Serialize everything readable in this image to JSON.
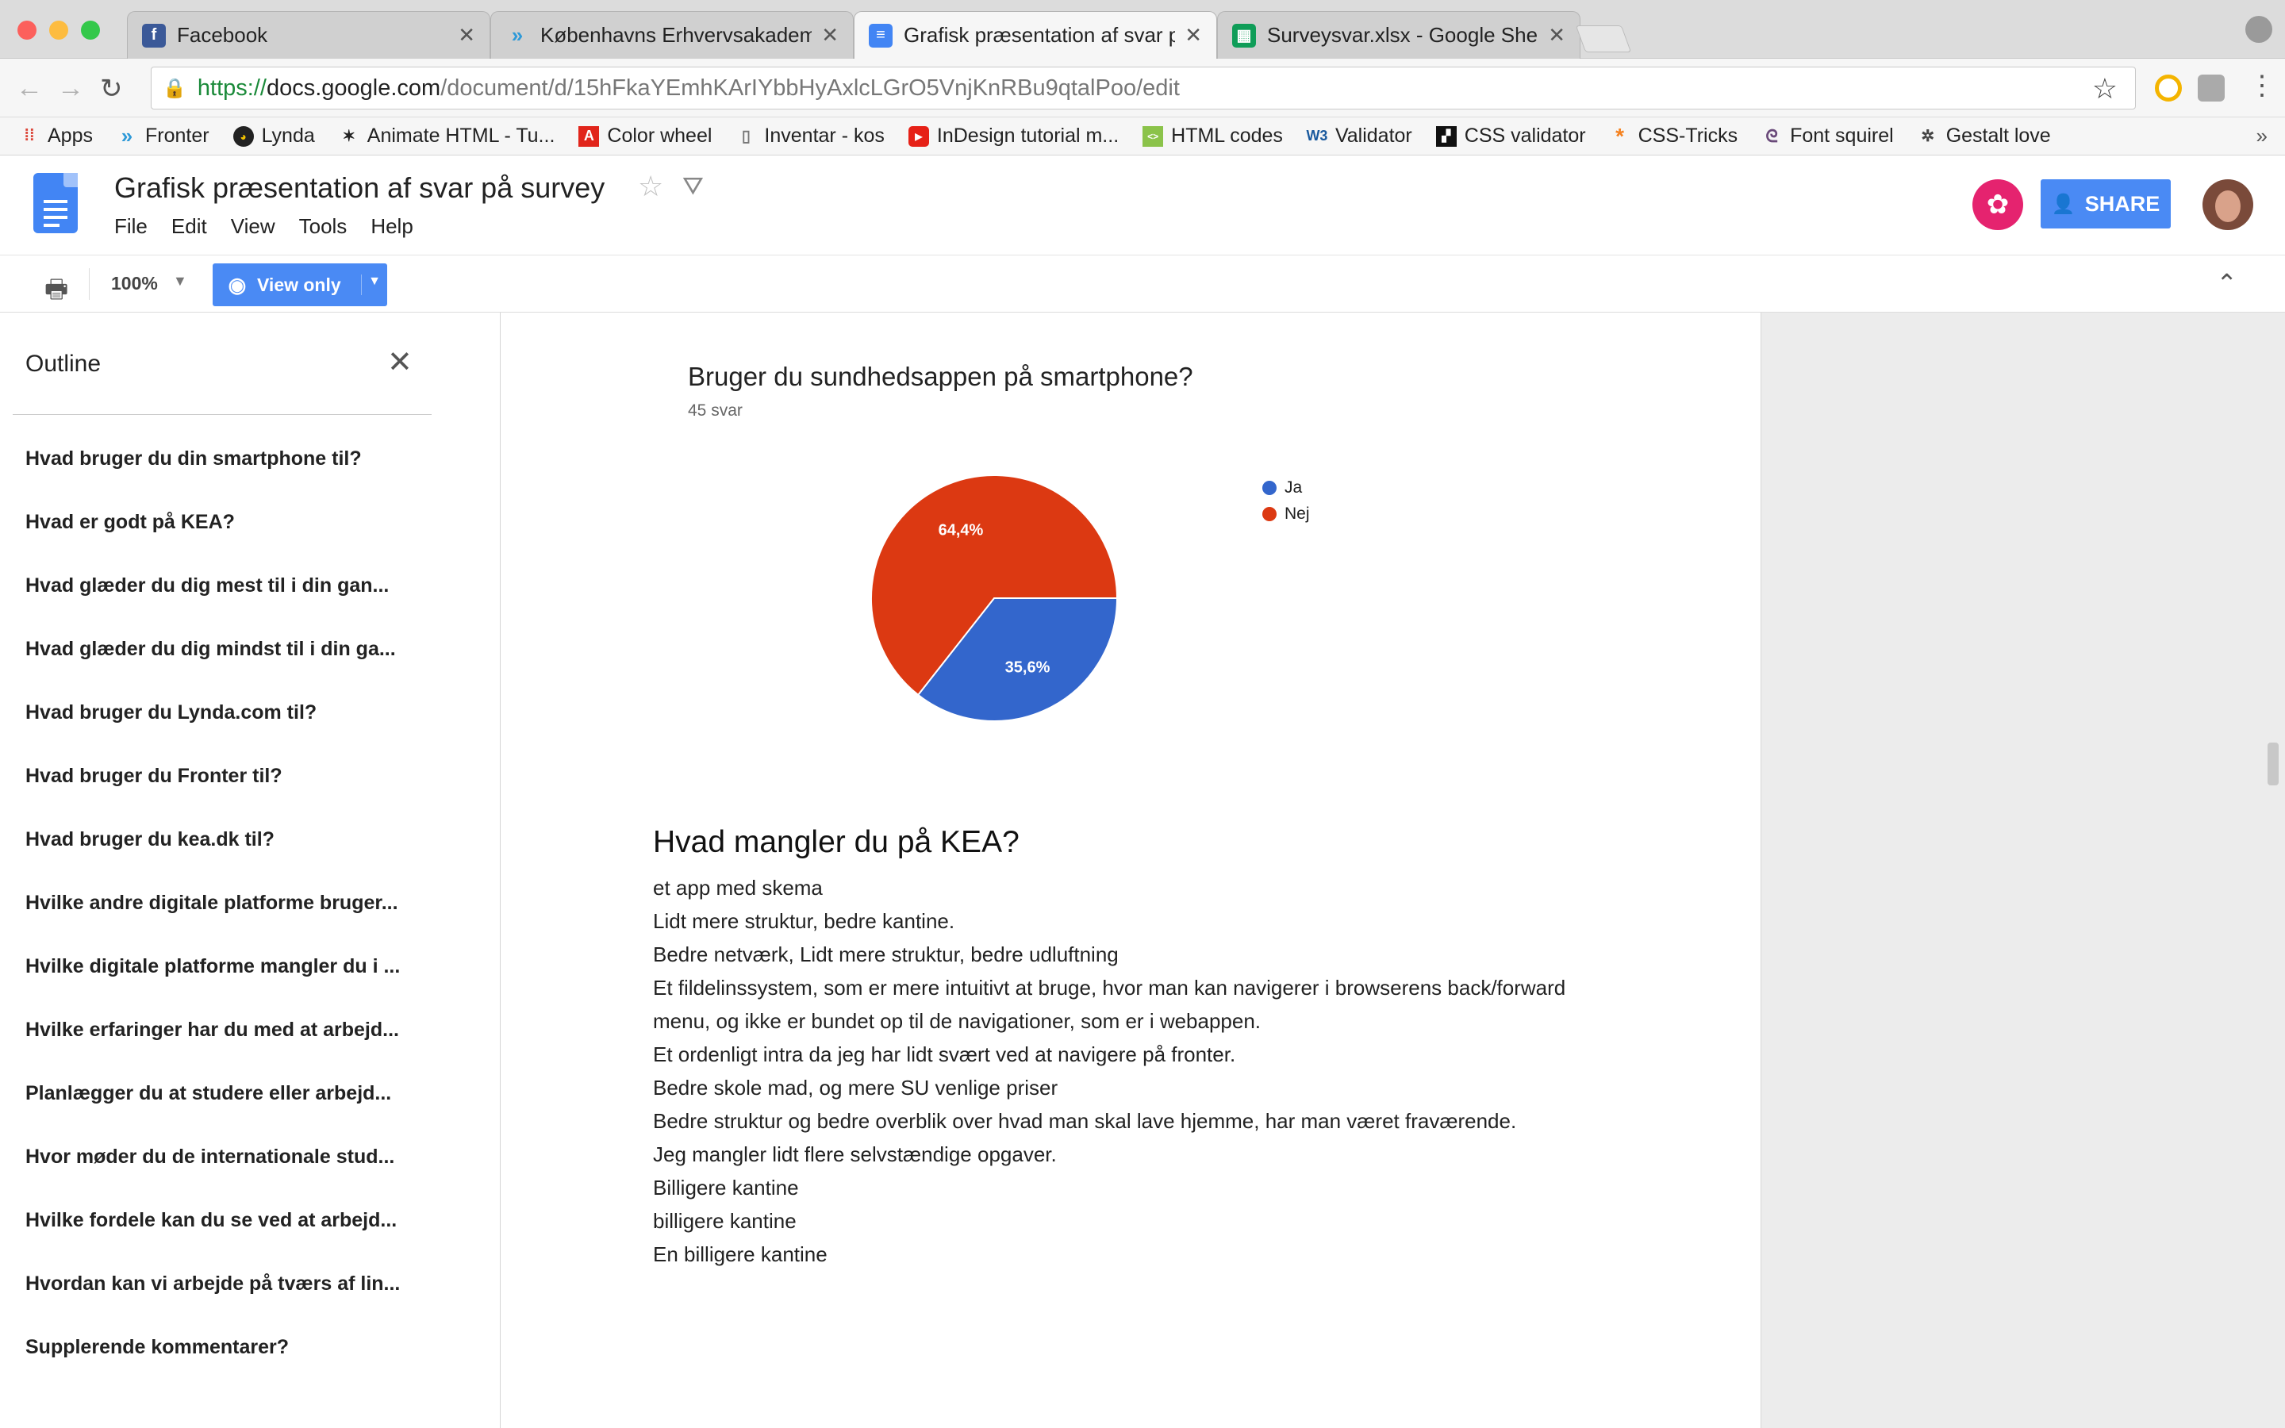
{
  "browser": {
    "tabs": [
      {
        "label": "Facebook",
        "icon": "facebook-icon",
        "color": "#3b5998"
      },
      {
        "label": "Københavns Erhvervsakademi",
        "icon": "fronter-icon",
        "color": "#2f9ad8"
      },
      {
        "label": "Grafisk præsentation af svar på",
        "icon": "docs-icon",
        "color": "#4285f4",
        "active": true
      },
      {
        "label": "Surveysvar.xlsx - Google Sheets",
        "icon": "sheets-icon",
        "color": "#0f9d58"
      }
    ],
    "url": {
      "scheme": "https://",
      "host": "docs.google.com",
      "path": "/document/d/15hFkaYEmhKArIYbbHyAxlcLGrO5VnjKnRBu9qtalPoo/edit"
    },
    "bookmarks": [
      {
        "label": "Apps",
        "icon": "apps-grid-icon"
      },
      {
        "label": "Fronter",
        "icon": "fronter-icon"
      },
      {
        "label": "Lynda",
        "icon": "lynda-icon"
      },
      {
        "label": "Animate HTML - Tu...",
        "icon": "animate-icon"
      },
      {
        "label": "Color wheel",
        "icon": "adobe-icon"
      },
      {
        "label": "Inventar - kos",
        "icon": "page-icon"
      },
      {
        "label": "InDesign tutorial m...",
        "icon": "youtube-icon"
      },
      {
        "label": "HTML codes",
        "icon": "html-codes-icon"
      },
      {
        "label": "Validator",
        "icon": "w3c-icon"
      },
      {
        "label": "CSS validator",
        "icon": "css-validator-icon"
      },
      {
        "label": "CSS-Tricks",
        "icon": "css-tricks-icon"
      },
      {
        "label": "Font squirel",
        "icon": "font-squirrel-icon"
      },
      {
        "label": "Gestalt love",
        "icon": "gestalt-icon"
      }
    ],
    "bookmarks_more": "»"
  },
  "doc": {
    "title": "Grafisk præsentation af svar på survey",
    "menu": [
      "File",
      "Edit",
      "View",
      "Tools",
      "Help"
    ],
    "share_label": "SHARE",
    "zoom": "100%",
    "mode_label": "View only"
  },
  "outline": {
    "title": "Outline",
    "items": [
      "Hvad bruger du din smartphone til?",
      "Hvad er godt på KEA?",
      "Hvad glæder du dig mest til i din gan...",
      "Hvad glæder du dig mindst til i din ga...",
      "Hvad bruger du Lynda.com til?",
      "Hvad bruger du Fronter til?",
      "Hvad bruger du kea.dk til?",
      "Hvilke andre digitale platforme bruger...",
      "Hvilke digitale platforme mangler du i ...",
      "Hvilke erfaringer har du med at arbejd...",
      "Planlægger du at studere eller arbejd...",
      "Hvor møder du de internationale stud...",
      "Hvilke fordele kan du se ved at arbejd...",
      "Hvordan kan vi arbejde på tværs af lin...",
      "Supplerende kommentarer?"
    ]
  },
  "chart_data": {
    "type": "pie",
    "title": "Bruger du sundhedsappen på smartphone?",
    "subtitle": "45 svar",
    "categories": [
      "Ja",
      "Nej"
    ],
    "values": [
      35.6,
      64.4
    ],
    "labels": [
      "35,6%",
      "64,4%"
    ],
    "colors": [
      "#3366cc",
      "#dc3912"
    ],
    "legend_position": "right"
  },
  "section": {
    "heading": "Hvad mangler du på KEA?",
    "answers": [
      "et app med skema",
      "Lidt mere struktur, bedre kantine.",
      "Bedre netværk, Lidt mere struktur, bedre udluftning",
      "Et fildelinssystem, som er mere intuitivt at bruge, hvor man kan navigerer i browserens back/forward",
      "menu, og ikke er bundet op til de navigationer, som er i webappen.",
      "Et ordenligt intra da jeg har lidt svært ved at navigere på fronter.",
      "Bedre skole mad, og mere SU venlige priser",
      "Bedre struktur og bedre overblik over hvad man skal lave hjemme, har man været fraværende.",
      "Jeg mangler lidt flere selvstændige opgaver.",
      "Billigere kantine",
      "billigere kantine",
      "En billigere kantine"
    ]
  }
}
